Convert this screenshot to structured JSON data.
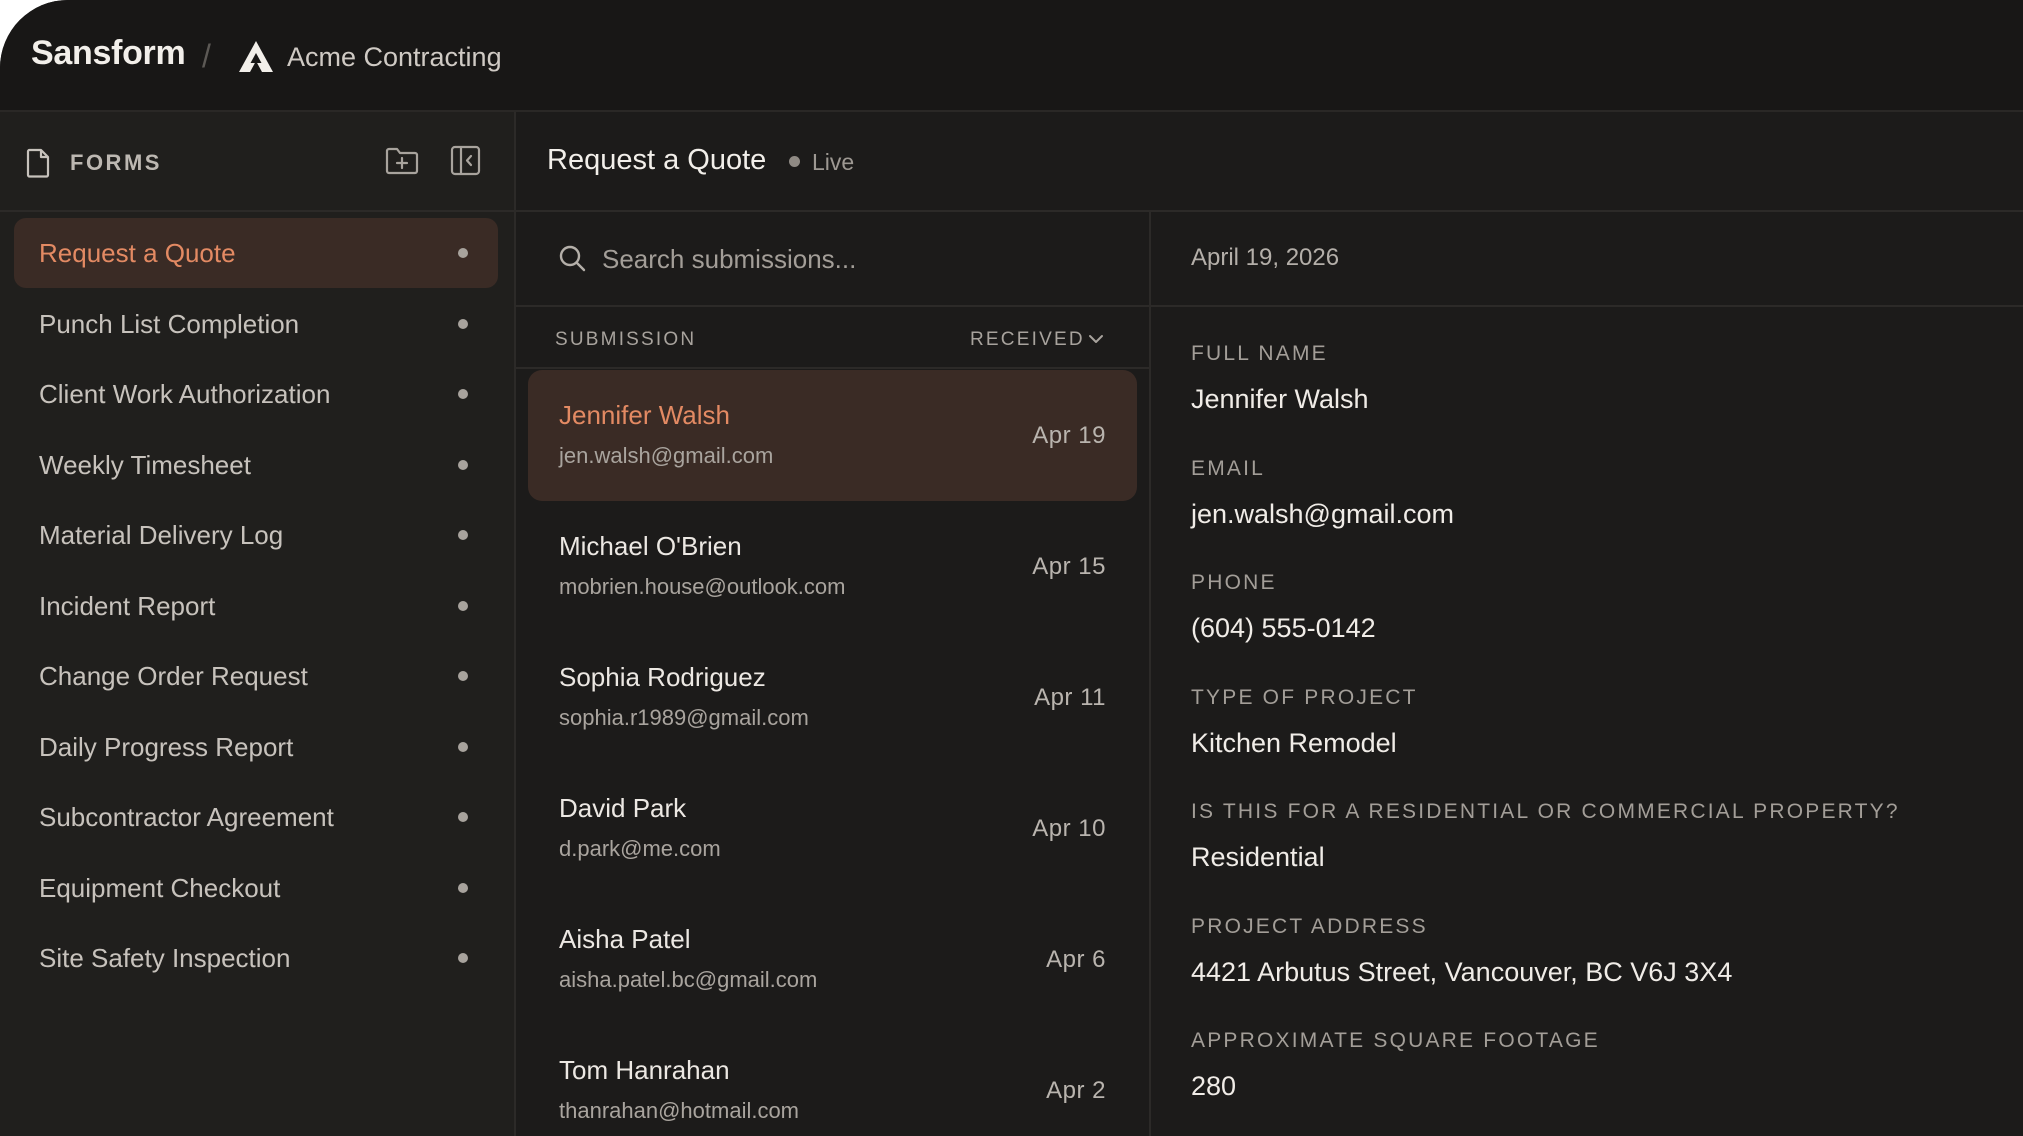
{
  "topbar": {
    "brand": "Sansform",
    "separator": "/",
    "org_icon": "triangle-logo-icon",
    "org_name": "Acme Contracting"
  },
  "sidebar": {
    "title": "FORMS",
    "icons": {
      "doc": "document-icon",
      "new_folder": "folder-plus-icon",
      "collapse": "sidebar-collapse-icon"
    },
    "items": [
      {
        "label": "Request a Quote",
        "active": true
      },
      {
        "label": "Punch List Completion"
      },
      {
        "label": "Client Work Authorization"
      },
      {
        "label": "Weekly Timesheet"
      },
      {
        "label": "Material Delivery Log"
      },
      {
        "label": "Incident Report"
      },
      {
        "label": "Change Order Request"
      },
      {
        "label": "Daily Progress Report"
      },
      {
        "label": "Subcontractor Agreement"
      },
      {
        "label": "Equipment Checkout"
      },
      {
        "label": "Site Safety Inspection"
      }
    ]
  },
  "main": {
    "form_title": "Request a Quote",
    "status": "Live"
  },
  "submissions": {
    "search_placeholder": "Search submissions...",
    "col_submission": "SUBMISSION",
    "col_received": "RECEIVED",
    "items": [
      {
        "name": "Jennifer Walsh",
        "email": "jen.walsh@gmail.com",
        "date": "Apr 19",
        "active": true
      },
      {
        "name": "Michael O'Brien",
        "email": "mobrien.house@outlook.com",
        "date": "Apr 15"
      },
      {
        "name": "Sophia Rodriguez",
        "email": "sophia.r1989@gmail.com",
        "date": "Apr 11"
      },
      {
        "name": "David Park",
        "email": "d.park@me.com",
        "date": "Apr 10"
      },
      {
        "name": "Aisha Patel",
        "email": "aisha.patel.bc@gmail.com",
        "date": "Apr 6"
      },
      {
        "name": "Tom Hanrahan",
        "email": "thanrahan@hotmail.com",
        "date": "Apr 2"
      }
    ]
  },
  "detail": {
    "date": "April 19, 2026",
    "fields": [
      {
        "label": "FULL NAME",
        "value": "Jennifer Walsh"
      },
      {
        "label": "EMAIL",
        "value": "jen.walsh@gmail.com"
      },
      {
        "label": "PHONE",
        "value": "(604) 555-0142"
      },
      {
        "label": "TYPE OF PROJECT",
        "value": "Kitchen Remodel"
      },
      {
        "label": "IS THIS FOR A RESIDENTIAL OR COMMERCIAL PROPERTY?",
        "value": "Residential"
      },
      {
        "label": "PROJECT ADDRESS",
        "value": "4421 Arbutus Street, Vancouver, BC V6J 3X4"
      },
      {
        "label": "APPROXIMATE SQUARE FOOTAGE",
        "value": "280"
      }
    ]
  },
  "colors": {
    "background": "#1c1b1a",
    "accent": "#e38a63",
    "active_bg": "#3a2b25"
  }
}
